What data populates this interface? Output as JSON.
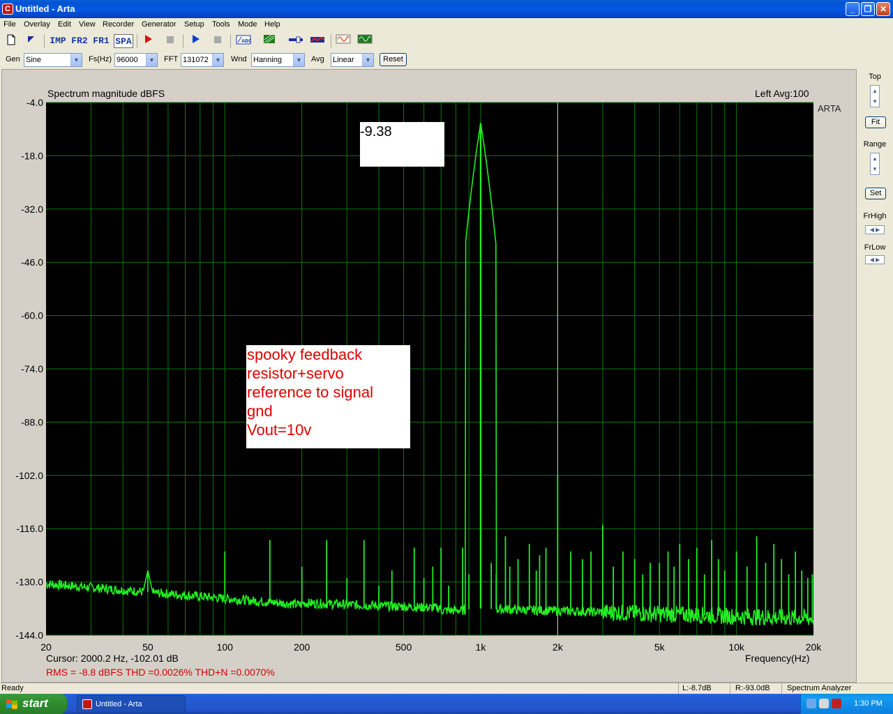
{
  "window": {
    "title": "Untitled - Arta",
    "app_icon_letter": "C"
  },
  "menu": [
    "File",
    "Overlay",
    "Edit",
    "View",
    "Recorder",
    "Generator",
    "Setup",
    "Tools",
    "Mode",
    "Help"
  ],
  "toolbar": {
    "mode_buttons": [
      "IMP",
      "FR2",
      "FR1",
      "SPA"
    ],
    "active_mode": "SPA"
  },
  "settings": {
    "gen_label": "Gen",
    "gen_value": "Sine",
    "fs_label": "Fs(Hz)",
    "fs_value": "96000",
    "fft_label": "FFT",
    "fft_value": "131072",
    "wnd_label": "Wnd",
    "wnd_value": "Hanning",
    "avg_label": "Avg",
    "avg_value": "Linear",
    "reset_label": "Reset"
  },
  "right_panel": {
    "top_label": "Top",
    "fit_label": "Fit",
    "range_label": "Range",
    "set_label": "Set",
    "frhigh_label": "FrHigh",
    "frlow_label": "FrLow"
  },
  "chart_data": {
    "type": "line",
    "title": "Spectrum magnitude dBFS",
    "channel_info": "Left  Avg:100",
    "side_label": "ARTA",
    "xlabel": "Frequency(Hz)",
    "x_scale": "log",
    "xlim": [
      20,
      20000
    ],
    "ylim": [
      -144,
      -4
    ],
    "y_ticks": [
      "-4.0",
      "-18.0",
      "-32.0",
      "-46.0",
      "-60.0",
      "-74.0",
      "-88.0",
      "-102.0",
      "-116.0",
      "-130.0",
      "-144.0"
    ],
    "x_tick_labels": [
      {
        "f": 20,
        "label": "20"
      },
      {
        "f": 50,
        "label": "50"
      },
      {
        "f": 100,
        "label": "100"
      },
      {
        "f": 200,
        "label": "200"
      },
      {
        "f": 500,
        "label": "500"
      },
      {
        "f": 1000,
        "label": "1k"
      },
      {
        "f": 2000,
        "label": "2k"
      },
      {
        "f": 5000,
        "label": "5k"
      },
      {
        "f": 10000,
        "label": "10k"
      },
      {
        "f": 20000,
        "label": "20k"
      }
    ],
    "grid": true,
    "background": "#000000",
    "line_color": "#22ee22",
    "grid_color": "#0c7a0c",
    "cursor_freq": 2000.2,
    "peaks": [
      {
        "f": 50,
        "db": -127
      },
      {
        "f": 100,
        "db": -122
      },
      {
        "f": 150,
        "db": -119
      },
      {
        "f": 200,
        "db": -126
      },
      {
        "f": 250,
        "db": -119
      },
      {
        "f": 300,
        "db": -129
      },
      {
        "f": 350,
        "db": -119
      },
      {
        "f": 400,
        "db": -131
      },
      {
        "f": 450,
        "db": -127
      },
      {
        "f": 550,
        "db": -121
      },
      {
        "f": 600,
        "db": -129
      },
      {
        "f": 650,
        "db": -126
      },
      {
        "f": 700,
        "db": -121
      },
      {
        "f": 750,
        "db": -131
      },
      {
        "f": 850,
        "db": -121
      },
      {
        "f": 900,
        "db": -128
      },
      {
        "f": 1000,
        "db": -9.38
      },
      {
        "f": 1100,
        "db": -125
      },
      {
        "f": 1150,
        "db": -128
      },
      {
        "f": 1250,
        "db": -118
      },
      {
        "f": 1300,
        "db": -126
      },
      {
        "f": 1400,
        "db": -124
      },
      {
        "f": 1550,
        "db": -120
      },
      {
        "f": 1650,
        "db": -127
      },
      {
        "f": 1700,
        "db": -123
      },
      {
        "f": 1800,
        "db": -121
      },
      {
        "f": 2000,
        "db": -102
      },
      {
        "f": 2250,
        "db": -122
      },
      {
        "f": 2500,
        "db": -124
      },
      {
        "f": 2700,
        "db": -122
      },
      {
        "f": 3000,
        "db": -115
      },
      {
        "f": 3300,
        "db": -126
      },
      {
        "f": 3600,
        "db": -122
      },
      {
        "f": 4000,
        "db": -124
      },
      {
        "f": 4300,
        "db": -128
      },
      {
        "f": 4600,
        "db": -125
      },
      {
        "f": 5000,
        "db": -125
      },
      {
        "f": 5400,
        "db": -122
      },
      {
        "f": 5700,
        "db": -126
      },
      {
        "f": 6000,
        "db": -120
      },
      {
        "f": 6500,
        "db": -124
      },
      {
        "f": 7000,
        "db": -121
      },
      {
        "f": 7500,
        "db": -128
      },
      {
        "f": 8000,
        "db": -119
      },
      {
        "f": 8500,
        "db": -124
      },
      {
        "f": 9000,
        "db": -127
      },
      {
        "f": 10000,
        "db": -122
      },
      {
        "f": 11000,
        "db": -126
      },
      {
        "f": 12000,
        "db": -118
      },
      {
        "f": 13000,
        "db": -125
      },
      {
        "f": 14000,
        "db": -120
      },
      {
        "f": 15000,
        "db": -124
      },
      {
        "f": 16000,
        "db": -128
      },
      {
        "f": 17000,
        "db": -122
      },
      {
        "f": 18000,
        "db": -127
      },
      {
        "f": 19000,
        "db": -129
      },
      {
        "f": 19800,
        "db": -128
      }
    ],
    "annotations": {
      "peak_box": "-9.38",
      "note_lines": [
        "spooky feedback",
        "resistor+servo",
        "reference to signal",
        "gnd",
        "Vout=10v"
      ]
    }
  },
  "readouts": {
    "cursor": "Cursor:  2000.2 Hz, -102.01 dB",
    "rms": "RMS =   -8.8 dBFS   THD =0.0026%   THD+N =0.0070%"
  },
  "status": {
    "ready": "Ready",
    "left_level": "L:-8.7dB",
    "right_level": "R:-93.0dB",
    "mode": "Spectrum Analyzer"
  },
  "taskbar": {
    "start_label": "start",
    "task_label": "Untitled - Arta",
    "clock": "1:30 PM"
  }
}
